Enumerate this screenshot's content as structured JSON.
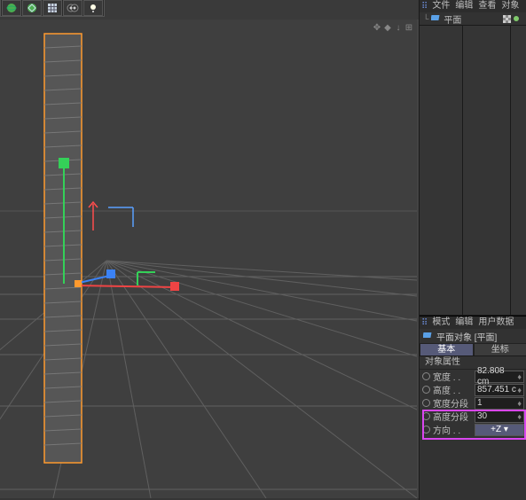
{
  "object_manager": {
    "tabs": [
      "文件",
      "编辑",
      "查看",
      "对象"
    ],
    "item": {
      "name": "平面"
    }
  },
  "attribute_manager": {
    "tabs": [
      "模式",
      "编辑",
      "用户数据"
    ],
    "title": "平面对象 [平面]",
    "tab_basic": "基本",
    "tab_coord": "坐标",
    "section": "对象属性",
    "rows": {
      "width": {
        "label": "宽度 . .",
        "value": "82.808 cm"
      },
      "height": {
        "label": "高度 . .",
        "value": "857.451 c"
      },
      "segw": {
        "label": "宽度分段",
        "value": "1"
      },
      "segh": {
        "label": "高度分段",
        "value": "30"
      },
      "orient": {
        "label": "方向 . .",
        "value": "+Z"
      }
    }
  },
  "viewport": {
    "icons": [
      "✥",
      "◆",
      "↓",
      "⊞"
    ]
  }
}
